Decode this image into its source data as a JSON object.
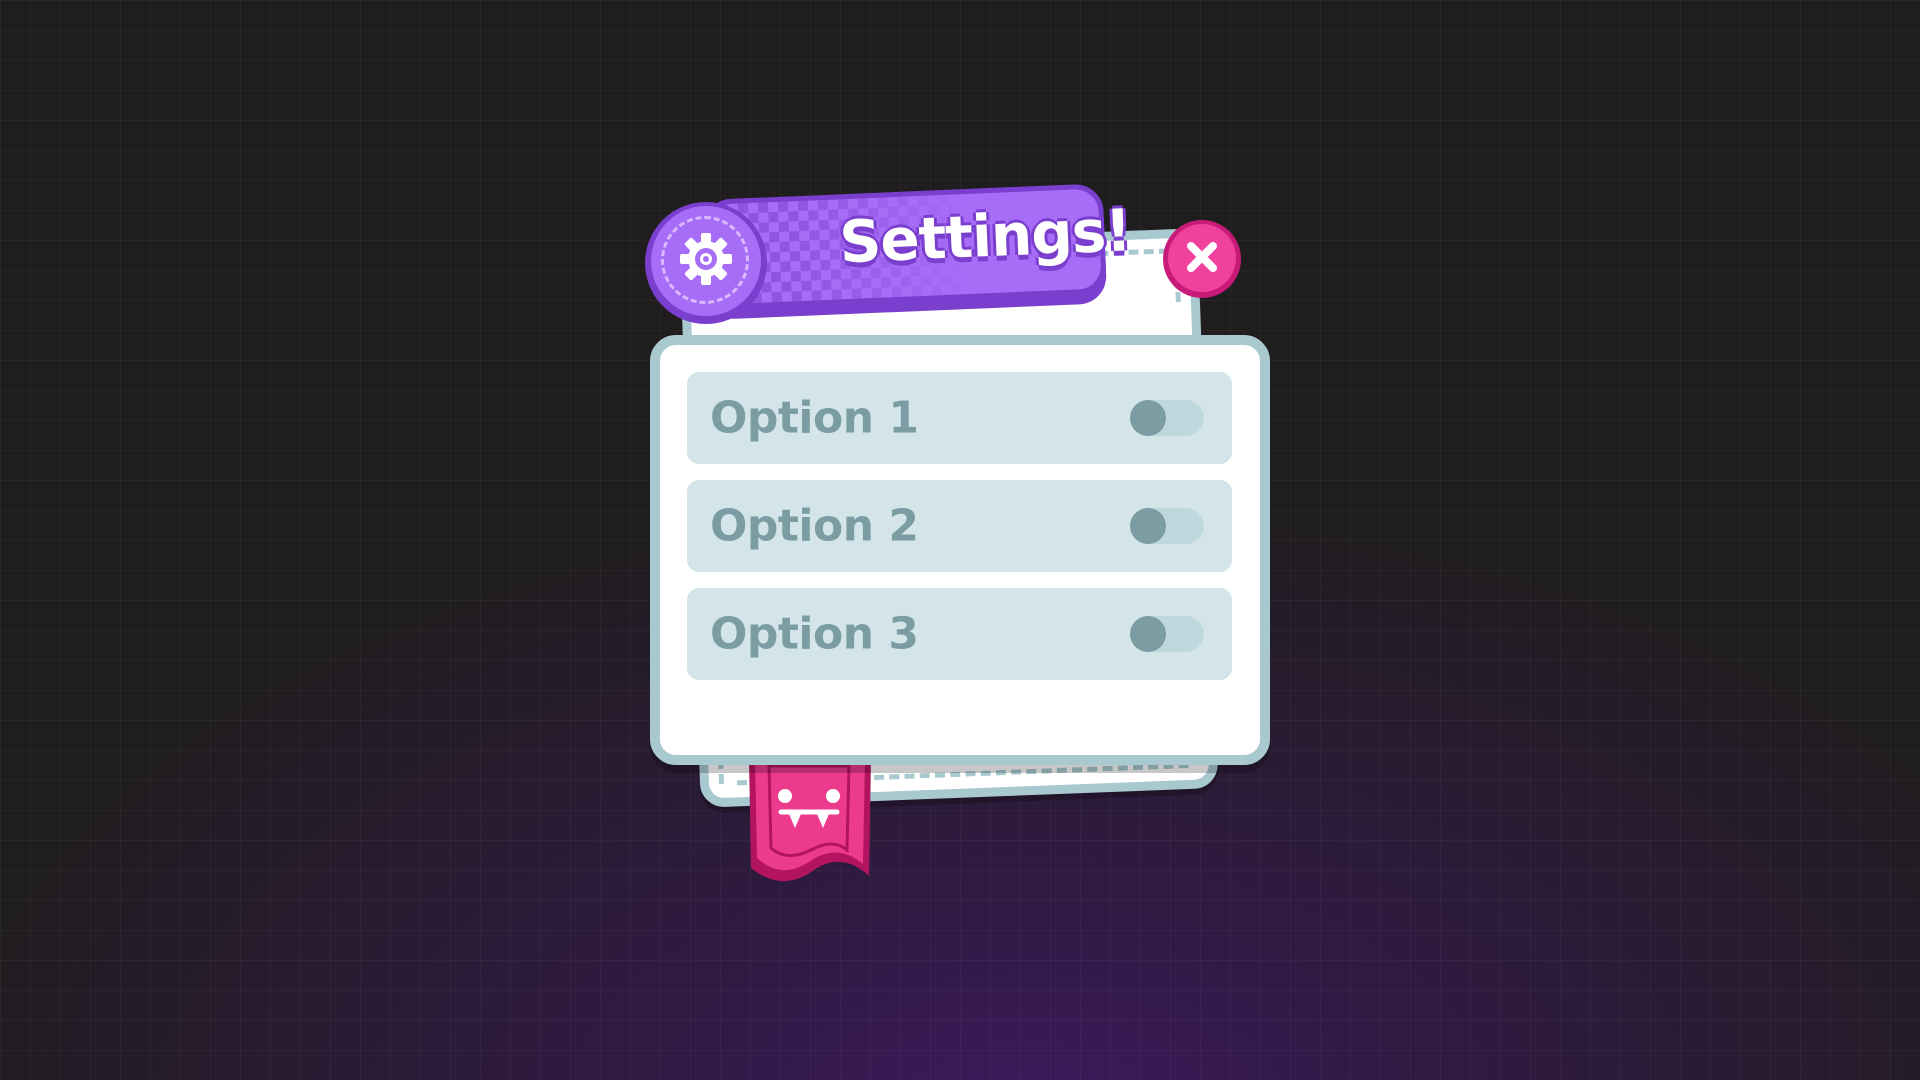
{
  "settings_dialog": {
    "title": "Settings!",
    "options": [
      {
        "label": "Option 1",
        "enabled": false
      },
      {
        "label": "Option 2",
        "enabled": false
      },
      {
        "label": "Option 3",
        "enabled": false
      }
    ]
  },
  "icons": {
    "header": "gear-icon",
    "close": "close-icon",
    "ribbon": "monster-face-icon"
  },
  "colors": {
    "banner": "#a86df7",
    "banner_dark": "#7b3fd0",
    "close": "#f0419d",
    "ribbon": "#ec3a8d",
    "panel_border": "#a9c9d0",
    "option_bg": "#d3e5e9",
    "option_text": "#7a9ca2"
  }
}
